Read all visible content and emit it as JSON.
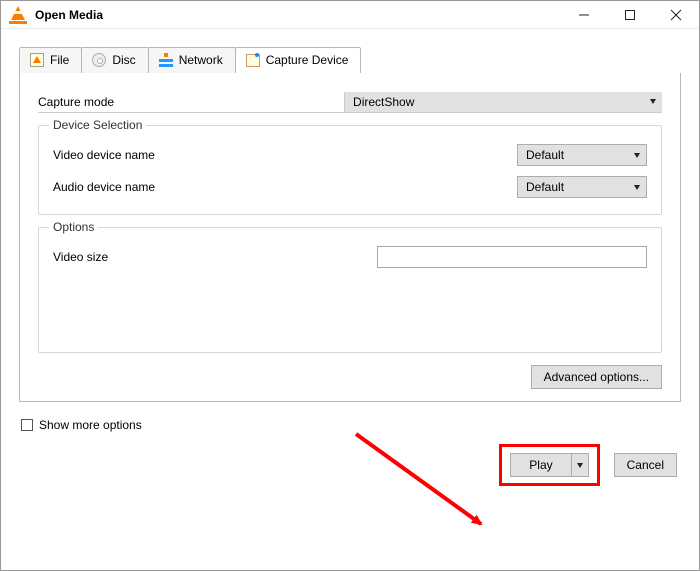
{
  "window": {
    "title": "Open Media"
  },
  "tabs": [
    {
      "id": "file",
      "label": "File",
      "icon": "file-icon"
    },
    {
      "id": "disc",
      "label": "Disc",
      "icon": "disc-icon"
    },
    {
      "id": "network",
      "label": "Network",
      "icon": "network-icon"
    },
    {
      "id": "capture",
      "label": "Capture Device",
      "icon": "capture-device-icon"
    }
  ],
  "activeTab": "capture",
  "captureMode": {
    "label": "Capture mode",
    "value": "DirectShow"
  },
  "deviceSelection": {
    "legend": "Device Selection",
    "videoLabel": "Video device name",
    "videoValue": "Default",
    "audioLabel": "Audio device name",
    "audioValue": "Default"
  },
  "options": {
    "legend": "Options",
    "videoSizeLabel": "Video size",
    "videoSizeValue": ""
  },
  "advanced": {
    "label": "Advanced options..."
  },
  "showMore": {
    "label": "Show more options"
  },
  "footer": {
    "play": "Play",
    "cancel": "Cancel"
  },
  "colors": {
    "highlight": "#ff0000"
  }
}
